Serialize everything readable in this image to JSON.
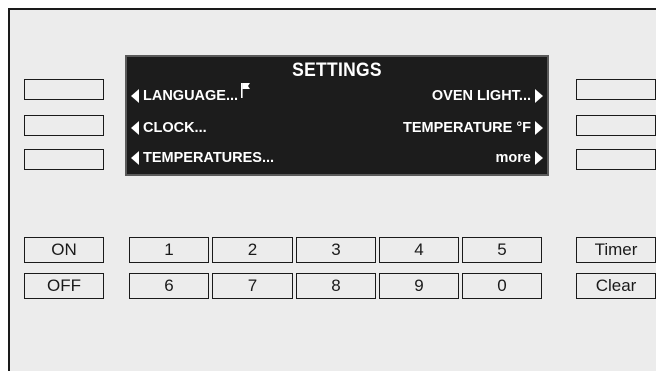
{
  "display": {
    "title": "SETTINGS",
    "left_options": [
      {
        "label": "LANGUAGE..."
      },
      {
        "label": "CLOCK..."
      },
      {
        "label": "TEMPERATURES..."
      }
    ],
    "right_options": [
      {
        "label": "OVEN LIGHT..."
      },
      {
        "label": "TEMPERATURE °F"
      },
      {
        "label": "more"
      }
    ]
  },
  "power_keys": {
    "on": "ON",
    "off": "OFF"
  },
  "number_keys": {
    "row1": [
      "1",
      "2",
      "3",
      "4",
      "5"
    ],
    "row2": [
      "6",
      "7",
      "8",
      "9",
      "0"
    ]
  },
  "function_keys": {
    "timer": "Timer",
    "clear": "Clear"
  },
  "colors": {
    "display_bg": "#1c1c1c",
    "panel_bg": "#ececec",
    "text": "#ffffff"
  }
}
